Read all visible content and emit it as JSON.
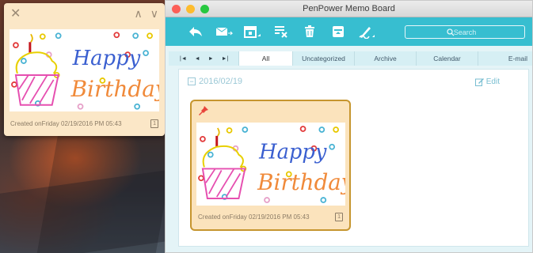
{
  "window": {
    "title": "PenPower Memo Board"
  },
  "toolbar": {
    "search_placeholder": "Search"
  },
  "tabs": [
    "All",
    "Uncategorized",
    "Archive",
    "Calendar",
    "E-mail"
  ],
  "active_tab": "All",
  "nav": {
    "first": "◄",
    "prev": "◄",
    "next": "►",
    "last": "►|"
  },
  "group": {
    "date": "2016/02/19",
    "collapse": "−",
    "edit_label": "Edit"
  },
  "memo": {
    "created": "Created onFriday 02/19/2016 PM 05:43",
    "page": "1",
    "drawing_text_line1": "Happy",
    "drawing_text_line2": "Birthday!"
  },
  "floating_memo": {
    "close": "✕",
    "collapse": "∧",
    "expand": "∨",
    "created": "Created onFriday 02/19/2016 PM 05:43",
    "page": "1"
  },
  "colors": {
    "toolbar": "#37bed0",
    "memo_bg": "#fbe3bc",
    "memo_border": "#c6952e",
    "close_light": "#fc5f57",
    "minimize_light": "#fdbc2e",
    "zoom_light": "#27c840"
  }
}
